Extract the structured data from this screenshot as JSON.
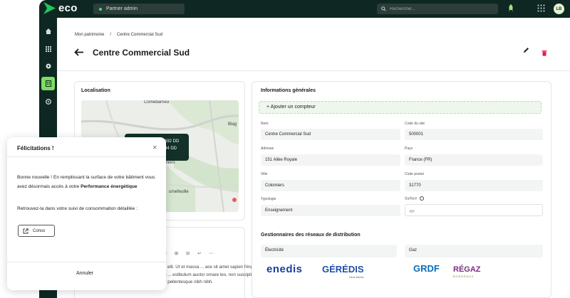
{
  "brand": {
    "name": "eco"
  },
  "topbar": {
    "partner_label": "Partner admin",
    "search_placeholder": "Rechercher...",
    "avatar_initials": "LB"
  },
  "breadcrumb": {
    "root": "Mon patrimoine",
    "separator": "/",
    "current": "Centre Commercial Sud"
  },
  "page": {
    "title": "Centre Commercial Sud"
  },
  "localisation": {
    "title": "Localisation",
    "map_labels": [
      "Cornebarrieu",
      "Blag",
      "miers",
      "urnefeuille"
    ],
    "popup_lines": [
      "692 DD",
      "94 DD"
    ]
  },
  "editor": {
    "toolbar": [
      "B",
      "I",
      "x²",
      "x₂",
      "⊞",
      "⊟",
      "↩",
      "⋯"
    ],
    "text": "consectetur adipiscing elit. Ut et massa ... ace sit amet sapien fringilla ... us. Maecenas vitae mattis ... estibulum auctor ornare leo, non suscipit magna interdum eu. Curabitur pellentesque nibh nibh."
  },
  "info": {
    "title": "Informations générales",
    "add_meter": "+ Ajouter un compteur",
    "fields": {
      "nom": {
        "label": "Nom",
        "value": "Centre Commercial Sud"
      },
      "code_site": {
        "label": "Code du site",
        "value": "500001"
      },
      "adresse": {
        "label": "Adresse",
        "value": "151 Allée Royale"
      },
      "pays": {
        "label": "Pays",
        "value": "France (FR)"
      },
      "ville": {
        "label": "Ville",
        "value": "Colomiers"
      },
      "code_postal": {
        "label": "Code postal",
        "value": "31770"
      },
      "typologie": {
        "label": "Typologie",
        "value": "Enseignement"
      },
      "surface": {
        "label": "Surface",
        "placeholder": "m²"
      }
    }
  },
  "gestionnaires": {
    "title": "Gestionnaires des réseaux de distribution",
    "electricite": {
      "label": "Électricité",
      "logos": [
        "enedis",
        "GÉRÉDIS"
      ],
      "geredis_sub": "Deux-Sèvres"
    },
    "gaz": {
      "label": "Gaz",
      "logos": [
        "GRDF",
        "RÉGAZ"
      ],
      "regaz_sub": "BORDEAUX"
    }
  },
  "modal": {
    "title": "Félicitations !",
    "body_1": "Bonne nouvelle ! En remplissant la surface de votre bâtiment vous avez désormais accès à votre",
    "body_1_bold": "Performance énergétique",
    "body_2": "Retrouvez-la dans votre suivi de consommation détaillée :",
    "link_label": "Conso",
    "cancel_label": "Annuler"
  },
  "colors": {
    "sidebar_bg": "#0f2722",
    "accent_green": "#7ddc63",
    "danger": "#e11d48",
    "enedis_blue": "#1b3fa0"
  }
}
